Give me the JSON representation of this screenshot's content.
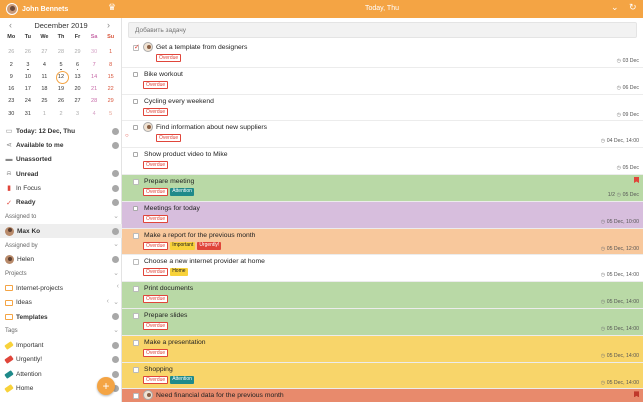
{
  "header": {
    "user_name": "John Bennets",
    "title": "Today, Thu",
    "crown_icon": "crown-icon",
    "colors": {
      "accent": "#f4a444",
      "red": "#e0453a",
      "teal": "#1f8a8a",
      "yellow": "#f8d23a"
    }
  },
  "calendar": {
    "month": "December 2019",
    "weekdays": [
      "Mo",
      "Tu",
      "We",
      "Th",
      "Fr",
      "Sa",
      "Su"
    ],
    "weeks": [
      [
        "26",
        "26",
        "27",
        "28",
        "29",
        "30",
        "1"
      ],
      [
        "2",
        "3",
        "4",
        "5",
        "6",
        "7",
        "8"
      ],
      [
        "9",
        "10",
        "11",
        "12",
        "13",
        "14",
        "15"
      ],
      [
        "16",
        "17",
        "18",
        "19",
        "20",
        "21",
        "22"
      ],
      [
        "23",
        "24",
        "25",
        "26",
        "27",
        "28",
        "29"
      ],
      [
        "30",
        "31",
        "1",
        "2",
        "3",
        "4",
        "5"
      ]
    ],
    "today": "12"
  },
  "sidebar": {
    "today": "Today: 12 Dec, Thu",
    "available": "Available to me",
    "unassorted": "Unassorted",
    "unread": "Unread",
    "in_focus": "In Focus",
    "ready": "Ready",
    "assigned_to_header": "Assigned to",
    "assigned_to_user": "Max Ko",
    "assigned_by_header": "Assigned by",
    "assigned_by_user": "Helen",
    "projects_header": "Projects",
    "projects": [
      "Internet-projects",
      "Ideas",
      "Templates"
    ],
    "tags_header": "Tags",
    "tags": [
      {
        "label": "Important",
        "color": "#f8d23a"
      },
      {
        "label": "Urgently!",
        "color": "#e0453a"
      },
      {
        "label": "Attention",
        "color": "#1f8a8a"
      },
      {
        "label": "Home",
        "color": "#f8d23a"
      }
    ],
    "add_button": "+"
  },
  "main": {
    "add_task_placeholder": "Добавить задачу",
    "tasks": [
      {
        "title": "Get a template from designers",
        "tags": [
          "Overdue"
        ],
        "date": "03 Dec",
        "bg": "#ffffff"
      },
      {
        "title": "Bike workout",
        "tags": [
          "Overdue"
        ],
        "date": "06 Dec",
        "bg": "#ffffff"
      },
      {
        "title": "Cycling every weekend",
        "tags": [
          "Overdue"
        ],
        "date": "09 Dec",
        "bg": "#ffffff"
      },
      {
        "title": "Find information about new suppliers",
        "tags": [
          "Overdue"
        ],
        "date": "04 Dec, 14:00",
        "bg": "#ffffff"
      },
      {
        "title": "Show product video to Mike",
        "tags": [
          "Overdue"
        ],
        "date": "05 Dec",
        "bg": "#ffffff"
      },
      {
        "title": "Prepare meeting",
        "tags": [
          "Overdue",
          "Attention"
        ],
        "date": "05 Dec",
        "subcount": "1/2",
        "bg": "#b9d9a6"
      },
      {
        "title": "Meetings for today",
        "tags": [
          "Overdue"
        ],
        "date": "05 Dec, 10:00",
        "bg": "#d7bedd"
      },
      {
        "title": "Make a report for the previous month",
        "tags": [
          "Overdue",
          "Important",
          "Urgently!"
        ],
        "date": "05 Dec, 12:00",
        "bg": "#f8c89c"
      },
      {
        "title": "Choose a new internet provider at home",
        "tags": [
          "Overdue",
          "Home"
        ],
        "date": "05 Dec, 14:00",
        "bg": "#ffffff"
      },
      {
        "title": "Print documents",
        "tags": [
          "Overdue"
        ],
        "date": "05 Dec, 14:00",
        "bg": "#b9d9a6"
      },
      {
        "title": "Prepare slides",
        "tags": [
          "Overdue"
        ],
        "date": "05 Dec, 14:00",
        "bg": "#b9d9a6"
      },
      {
        "title": "Make a presentation",
        "tags": [
          "Overdue"
        ],
        "date": "05 Dec, 14:00",
        "bg": "#f8d56a"
      },
      {
        "title": "Shopping",
        "tags": [
          "Overdue",
          "Attention"
        ],
        "date": "05 Dec, 14:00",
        "bg": "#f8d56a"
      },
      {
        "title": "Need financial data for the previous month",
        "tags": [],
        "date": "",
        "bg": "#e88a6c"
      }
    ]
  }
}
